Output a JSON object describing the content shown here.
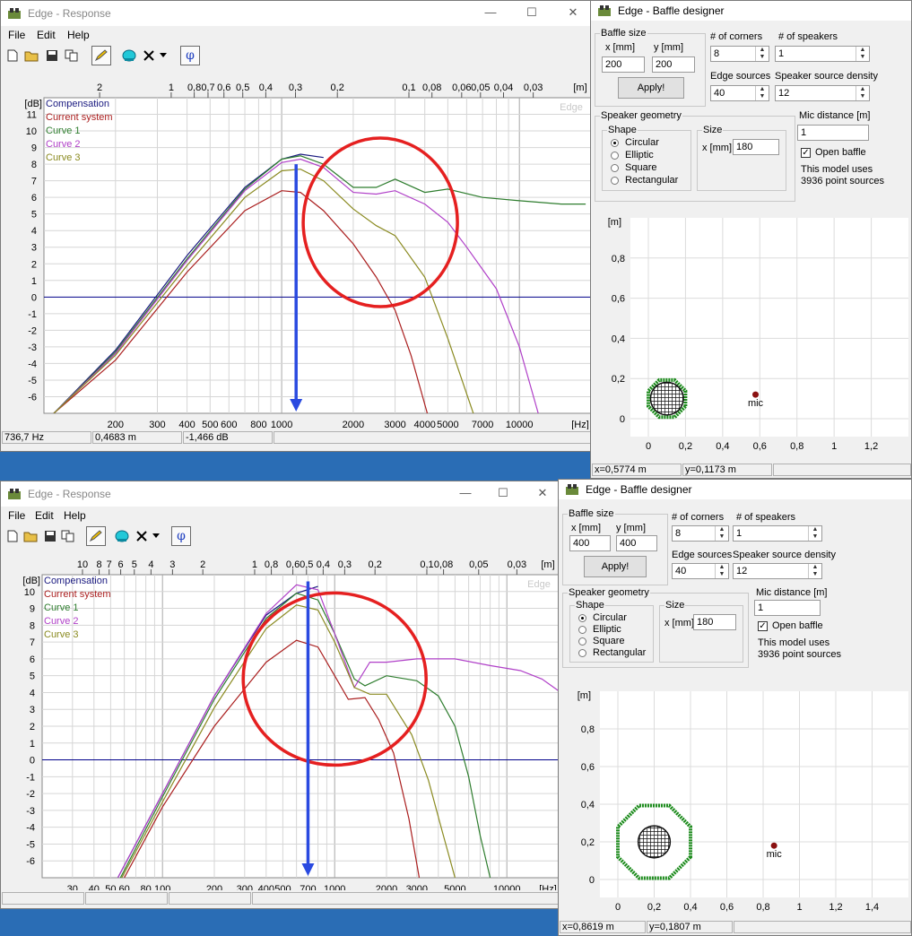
{
  "colors": {
    "compensation": "#1a1a80",
    "current_system": "#aa1e1e",
    "curve1": "#2e7d2e",
    "curve2": "#b040c8",
    "curve3": "#8a8a20",
    "highlight_circle": "#e52020",
    "arrow": "#2a4ae0",
    "zero_line": "#00008a",
    "baffle_green": "#1a8a1a"
  },
  "top": {
    "response": {
      "title": "Edge - Response",
      "menu": [
        "File",
        "Edit",
        "Help"
      ],
      "edge_watermark": "Edge",
      "status": {
        "freq": "736,7 Hz",
        "dist": "0,4683 m",
        "level": "-1,466 dB"
      }
    },
    "designer": {
      "title": "Edge - Baffle designer",
      "baffle_size_label": "Baffle size",
      "x_label": "x [mm]",
      "y_label": "y [mm]",
      "x_value": "200",
      "y_value": "200",
      "apply_label": "Apply!",
      "corners_label": "# of corners",
      "corners_value": "8",
      "speakers_label": "# of speakers",
      "speakers_value": "1",
      "edge_sources_label": "Edge sources",
      "edge_sources_value": "40",
      "density_label": "Speaker source density",
      "density_value": "12",
      "geometry_label": "Speaker geometry",
      "shape_label": "Shape",
      "shapes": [
        "Circular",
        "Elliptic",
        "Square",
        "Rectangular"
      ],
      "size_label": "Size",
      "size_x_label": "x [mm]",
      "size_value": "180",
      "mic_label": "Mic distance [m]",
      "mic_value": "1",
      "open_baffle_label": "Open baffle",
      "model_line1": "This model uses",
      "model_line2": "3936 point sources",
      "mic_text": "mic",
      "status": {
        "x": "x=0,5774 m",
        "y": "y=0,1173 m"
      }
    }
  },
  "bottom": {
    "response": {
      "title": "Edge - Response",
      "menu": [
        "File",
        "Edit",
        "Help"
      ],
      "edge_watermark": "Edge",
      "status": {
        "freq": "",
        "dist": "",
        "level": ""
      }
    },
    "designer": {
      "title": "Edge - Baffle designer",
      "baffle_size_label": "Baffle size",
      "x_label": "x [mm]",
      "y_label": "y [mm]",
      "x_value": "400",
      "y_value": "400",
      "apply_label": "Apply!",
      "corners_label": "# of corners",
      "corners_value": "8",
      "speakers_label": "# of speakers",
      "speakers_value": "1",
      "edge_sources_label": "Edge sources",
      "edge_sources_value": "40",
      "density_label": "Speaker source density",
      "density_value": "12",
      "geometry_label": "Speaker geometry",
      "shape_label": "Shape",
      "shapes": [
        "Circular",
        "Elliptic",
        "Square",
        "Rectangular"
      ],
      "size_label": "Size",
      "size_x_label": "x [mm]",
      "size_value": "180",
      "mic_label": "Mic distance [m]",
      "mic_value": "1",
      "open_baffle_label": "Open baffle",
      "model_line1": "This model uses",
      "model_line2": "3936 point sources",
      "mic_text": "mic",
      "status": {
        "x": "x=0,8619 m",
        "y": "y=0,1807 m"
      }
    }
  },
  "chart_data": [
    {
      "type": "line",
      "xscale": "log",
      "xlim": [
        100,
        20000
      ],
      "ylim": [
        -7,
        12
      ],
      "xlabel_unit": "[Hz]",
      "ylabel_unit": "[dB]",
      "top_axis_unit": "[m]",
      "x_ticks": [
        200,
        300,
        400,
        500,
        600,
        800,
        1000,
        2000,
        3000,
        4000,
        5000,
        7000,
        10000
      ],
      "x_tick_labels": [
        "200",
        "300",
        "400",
        "500",
        "600",
        "800",
        "1000",
        "2000",
        "3000",
        "4000",
        "5000",
        "7000",
        "10000"
      ],
      "y_ticks": [
        -6,
        -5,
        -4,
        -3,
        -2,
        -1,
        0,
        1,
        2,
        3,
        4,
        5,
        6,
        7,
        8,
        9,
        10,
        11
      ],
      "top_ticks": [
        2,
        1,
        0.8,
        0.7,
        0.6,
        0.5,
        0.4,
        0.3,
        0.2,
        0.1,
        0.08,
        0.06,
        0.05,
        0.04,
        0.03
      ],
      "top_tick_labels": [
        "2",
        "1",
        "0,8",
        "0,7",
        "0,6",
        "0,5",
        "0,4",
        "0,3",
        "0,2",
        "0,1",
        "0,08",
        "0,06",
        "0,05",
        "0,04",
        "0,03"
      ],
      "legend": [
        "Compensation",
        "Current system",
        "Curve 1",
        "Curve 2",
        "Curve 3"
      ],
      "marker_frequency": 1150,
      "highlight_circle_center": [
        2600,
        4.5
      ],
      "series": [
        {
          "name": "Compensation",
          "x": [
            110,
            200,
            400,
            700,
            1000,
            1200,
            1500
          ],
          "y": [
            -7,
            -3.2,
            2.5,
            6.6,
            8.3,
            8.6,
            8.4
          ]
        },
        {
          "name": "Current system",
          "x": [
            110,
            200,
            400,
            700,
            1000,
            1200,
            1500,
            2000,
            2500,
            3000,
            3500,
            4100
          ],
          "y": [
            -7,
            -3.8,
            1.5,
            5.2,
            6.4,
            6.3,
            5.2,
            3.2,
            1.2,
            -0.8,
            -3.5,
            -7
          ]
        },
        {
          "name": "Curve 1",
          "x": [
            110,
            200,
            400,
            700,
            1000,
            1200,
            1500,
            2000,
            2500,
            3000,
            4000,
            5000,
            7000,
            10000,
            15000,
            19000
          ],
          "y": [
            -7,
            -3.3,
            2.3,
            6.5,
            8.3,
            8.5,
            8.0,
            6.6,
            6.6,
            7.1,
            6.3,
            6.5,
            6.0,
            5.8,
            5.6,
            5.6
          ]
        },
        {
          "name": "Curve 2",
          "x": [
            110,
            200,
            400,
            700,
            1000,
            1200,
            1500,
            2000,
            2500,
            3000,
            4000,
            5000,
            6000,
            8000,
            10000,
            12000
          ],
          "y": [
            -7,
            -3.4,
            2.2,
            6.4,
            8.1,
            8.3,
            7.8,
            6.3,
            6.2,
            6.4,
            5.6,
            4.5,
            3.0,
            0.5,
            -3,
            -7
          ]
        },
        {
          "name": "Curve 3",
          "x": [
            110,
            200,
            400,
            700,
            1000,
            1200,
            1500,
            2000,
            2500,
            3000,
            4000,
            5000,
            6400
          ],
          "y": [
            -7,
            -3.5,
            1.9,
            6.0,
            7.6,
            7.7,
            7.0,
            5.3,
            4.3,
            3.7,
            1.2,
            -2.5,
            -7
          ]
        }
      ]
    },
    {
      "type": "line",
      "xscale": "log",
      "xlim": [
        20,
        20000
      ],
      "ylim": [
        -7,
        11
      ],
      "xlabel_unit": "[Hz]",
      "ylabel_unit": "[dB]",
      "top_axis_unit": "[m]",
      "x_ticks": [
        30,
        40,
        50,
        60,
        80,
        100,
        200,
        300,
        400,
        500,
        700,
        1000,
        2000,
        3000,
        5000,
        10000
      ],
      "x_tick_labels": [
        "30",
        "40",
        "50",
        "60",
        "80",
        "100",
        "200",
        "300",
        "400",
        "500",
        "700",
        "1000",
        "2000",
        "3000",
        "5000",
        "10000"
      ],
      "y_ticks": [
        -6,
        -5,
        -4,
        -3,
        -2,
        -1,
        0,
        1,
        2,
        3,
        4,
        5,
        6,
        7,
        8,
        9,
        10
      ],
      "top_ticks": [
        10,
        8,
        7,
        6,
        5,
        4,
        3,
        2,
        1,
        0.8,
        0.6,
        0.5,
        0.4,
        0.3,
        0.2,
        0.1,
        0.08,
        0.05,
        0.03
      ],
      "top_tick_labels": [
        "10",
        "8",
        "7",
        "6",
        "5",
        "4",
        "3",
        "2",
        "1",
        "0,8",
        "0,6",
        "0,5",
        "0,4",
        "0,3",
        "0,2",
        "0,1",
        "0,08",
        "0,05",
        "0,03"
      ],
      "legend": [
        "Compensation",
        "Current system",
        "Curve 1",
        "Curve 2",
        "Curve 3"
      ],
      "marker_frequency": 700,
      "highlight_circle_center": [
        1000,
        4.8
      ],
      "series": [
        {
          "name": "Compensation",
          "x": [
            55,
            100,
            200,
            400,
            600,
            800
          ],
          "y": [
            -7,
            -2.0,
            3.8,
            8.6,
            9.9,
            10.3
          ]
        },
        {
          "name": "Current system",
          "x": [
            60,
            100,
            200,
            400,
            600,
            800,
            1000,
            1200,
            1500,
            1800,
            2200,
            2700,
            3100
          ],
          "y": [
            -7,
            -2.8,
            2.0,
            5.8,
            7.1,
            6.7,
            5.0,
            3.6,
            3.7,
            2.4,
            0.4,
            -3.5,
            -7
          ]
        },
        {
          "name": "Curve 1",
          "x": [
            57,
            100,
            200,
            400,
            600,
            800,
            1000,
            1300,
            1500,
            2000,
            3000,
            4000,
            5000,
            6000,
            7000,
            8000
          ],
          "y": [
            -7,
            -2.2,
            3.6,
            8.4,
            9.9,
            9.5,
            7.5,
            4.8,
            4.4,
            5.0,
            4.7,
            3.8,
            2.0,
            -1.0,
            -4.5,
            -7
          ]
        },
        {
          "name": "Curve 2",
          "x": [
            55,
            100,
            200,
            400,
            600,
            800,
            1000,
            1300,
            1600,
            2000,
            3000,
            5000,
            8000,
            12000,
            16000,
            20000
          ],
          "y": [
            -7,
            -2.0,
            3.8,
            8.7,
            10.4,
            10.1,
            7.5,
            4.3,
            5.8,
            5.8,
            6.0,
            6.0,
            5.6,
            5.3,
            4.8,
            4.1
          ]
        },
        {
          "name": "Curve 3",
          "x": [
            58,
            100,
            200,
            400,
            600,
            800,
            1000,
            1300,
            1600,
            2000,
            2800,
            3500,
            4200,
            5000
          ],
          "y": [
            -7,
            -2.5,
            3.1,
            7.8,
            9.2,
            8.9,
            7.0,
            4.3,
            3.9,
            3.9,
            1.5,
            -1.2,
            -4.2,
            -7
          ]
        }
      ]
    }
  ]
}
